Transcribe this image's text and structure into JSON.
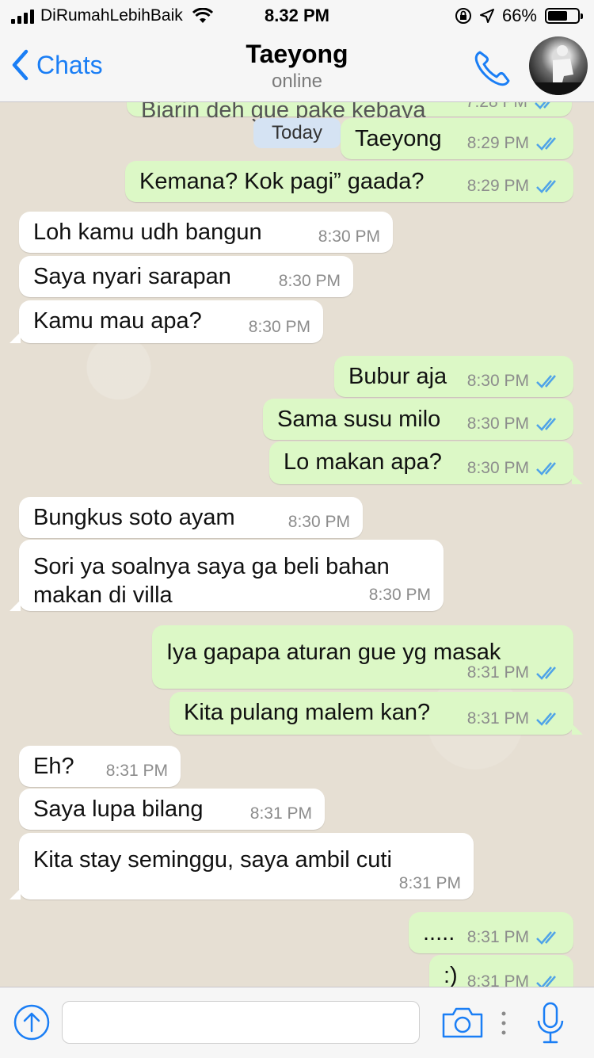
{
  "status_bar": {
    "carrier": "DiRumahLebihBaik",
    "time": "8.32 PM",
    "battery": "66%",
    "battery_level": 0.66,
    "icons": [
      "signal-icon",
      "wifi-icon",
      "rotation-lock-icon",
      "location-icon",
      "battery-icon"
    ]
  },
  "nav": {
    "back_label": "Chats",
    "contact_name": "Taeyong",
    "contact_status": "online",
    "icons": [
      "chevron-left-icon",
      "phone-icon",
      "avatar"
    ]
  },
  "chat": {
    "date_badge": "Today",
    "clipped_top": {
      "text": "Biarin deh gue pake kebaya",
      "time": "7:28 PM"
    },
    "messages": [
      {
        "dir": "out",
        "text": "Taeyong",
        "time": "8:29 PM"
      },
      {
        "dir": "out",
        "text": "Kemana? Kok pagi” gaada?",
        "time": "8:29 PM"
      },
      {
        "dir": "in",
        "text": "Loh kamu udh bangun",
        "time": "8:30 PM"
      },
      {
        "dir": "in",
        "text": "Saya nyari sarapan",
        "time": "8:30 PM"
      },
      {
        "dir": "in",
        "text": "Kamu mau apa?",
        "time": "8:30 PM"
      },
      {
        "dir": "out",
        "text": "Bubur aja",
        "time": "8:30 PM"
      },
      {
        "dir": "out",
        "text": "Sama susu milo",
        "time": "8:30 PM"
      },
      {
        "dir": "out",
        "text": "Lo makan apa?",
        "time": "8:30 PM"
      },
      {
        "dir": "in",
        "text": "Bungkus soto ayam",
        "time": "8:30 PM"
      },
      {
        "dir": "in",
        "text": "Sori ya soalnya saya ga beli bahan\nmakan di villa",
        "time": "8:30 PM"
      },
      {
        "dir": "out",
        "text": "Iya gapapa aturan gue yg masak",
        "time": "8:31 PM"
      },
      {
        "dir": "out",
        "text": "Kita pulang malem kan?",
        "time": "8:31 PM"
      },
      {
        "dir": "in",
        "text": "Eh?",
        "time": "8:31 PM"
      },
      {
        "dir": "in",
        "text": "Saya lupa bilang",
        "time": "8:31 PM"
      },
      {
        "dir": "in",
        "text": "Kita stay seminggu, saya ambil cuti",
        "time": "8:31 PM"
      },
      {
        "dir": "out",
        "text": ".....",
        "time": "8:31 PM"
      },
      {
        "dir": "out",
        "text": ":)",
        "time": "8:31 PM"
      }
    ]
  },
  "input_bar": {
    "placeholder": "",
    "icons": [
      "arrow-up-circle-icon",
      "camera-icon",
      "more-dots-icon",
      "microphone-icon"
    ]
  },
  "colors": {
    "accent": "#1a7ef5",
    "outgoing_bubble": "#dcf8c6",
    "incoming_bubble": "#ffffff",
    "chat_background": "#e6dfd3",
    "read_ticks": "#4fa3e8"
  }
}
